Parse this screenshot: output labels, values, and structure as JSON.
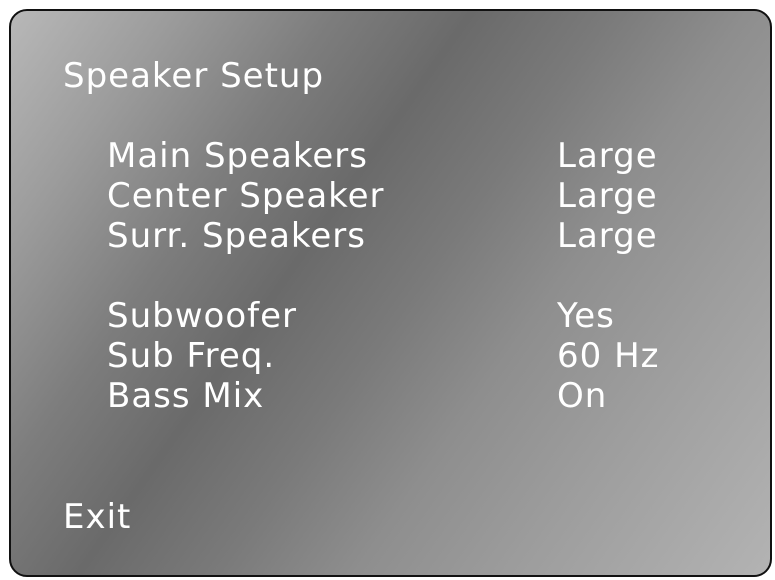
{
  "menu": {
    "title": "Speaker Setup",
    "items": [
      {
        "label": "Main Speakers",
        "value": "Large"
      },
      {
        "label": "Center Speaker",
        "value": "Large"
      },
      {
        "label": "Surr. Speakers",
        "value": "Large"
      },
      {
        "label": "Subwoofer",
        "value": "Yes"
      },
      {
        "label": "Sub Freq.",
        "value": "60 Hz"
      },
      {
        "label": "Bass Mix",
        "value": "On"
      }
    ],
    "exit_label": "Exit"
  },
  "colors": {
    "text": "#ffffff",
    "border": "#111111",
    "panel_dark": "#6a6a6a",
    "panel_light": "#b8b8b8"
  }
}
